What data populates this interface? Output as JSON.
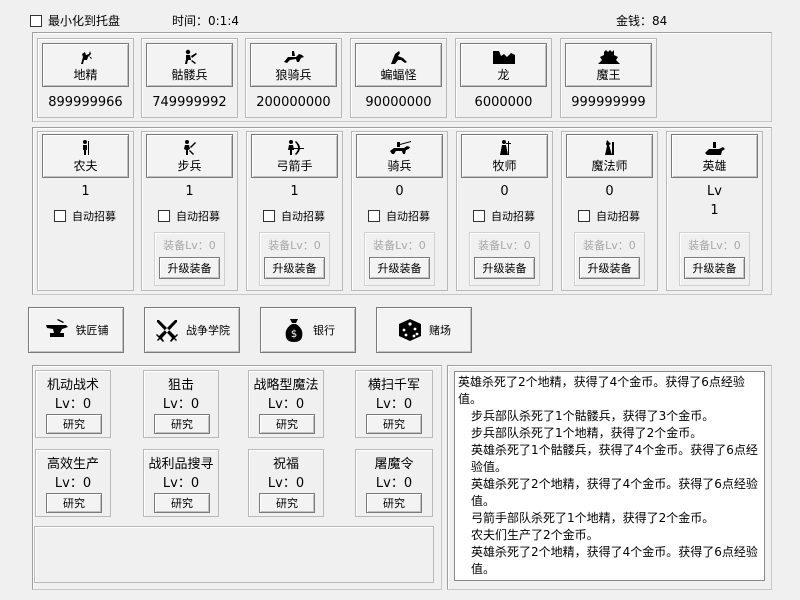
{
  "topbar": {
    "minimize_label": "最小化到托盘",
    "time_label": "时间：0:1:4",
    "money_label": "金钱：84"
  },
  "enemies": [
    {
      "name": "地精",
      "count": "899999966",
      "icon": "goblin-icon"
    },
    {
      "name": "骷髅兵",
      "count": "749999992",
      "icon": "skeleton-icon"
    },
    {
      "name": "狼骑兵",
      "count": "200000000",
      "icon": "wolf-rider-icon"
    },
    {
      "name": "蝙蝠怪",
      "count": "90000000",
      "icon": "bat-icon"
    },
    {
      "name": "龙",
      "count": "6000000",
      "icon": "dragon-icon"
    },
    {
      "name": "魔王",
      "count": "999999999",
      "icon": "demon-king-icon"
    }
  ],
  "units": [
    {
      "name": "农夫",
      "count": "1",
      "auto_label": "自动招募",
      "icon": "farmer-icon"
    },
    {
      "name": "步兵",
      "count": "1",
      "auto_label": "自动招募",
      "equip_label": "装备Lv：0",
      "upgrade_label": "升级装备",
      "icon": "infantry-icon"
    },
    {
      "name": "弓箭手",
      "count": "1",
      "auto_label": "自动招募",
      "equip_label": "装备Lv：0",
      "upgrade_label": "升级装备",
      "icon": "archer-icon"
    },
    {
      "name": "骑兵",
      "count": "0",
      "auto_label": "自动招募",
      "equip_label": "装备Lv：0",
      "upgrade_label": "升级装备",
      "icon": "cavalry-icon"
    },
    {
      "name": "牧师",
      "count": "0",
      "auto_label": "自动招募",
      "equip_label": "装备Lv：0",
      "upgrade_label": "升级装备",
      "icon": "priest-icon"
    },
    {
      "name": "魔法师",
      "count": "0",
      "auto_label": "自动招募",
      "equip_label": "装备Lv：0",
      "upgrade_label": "升级装备",
      "icon": "mage-icon"
    }
  ],
  "hero": {
    "name": "英雄",
    "lv_label": "Lv",
    "lv_value": "1",
    "equip_label": "装备Lv：0",
    "upgrade_label": "升级装备",
    "icon": "hero-icon"
  },
  "buildings": [
    {
      "label": "铁匠铺",
      "icon": "anvil-icon"
    },
    {
      "label": "战争学院",
      "icon": "crossed-swords-icon"
    },
    {
      "label": "银行",
      "icon": "money-bag-icon"
    },
    {
      "label": "赌场",
      "icon": "dice-icon"
    }
  ],
  "research": [
    {
      "title": "机动战术",
      "lv": "Lv：0",
      "button": "研究"
    },
    {
      "title": "狙击",
      "lv": "Lv：0",
      "button": "研究"
    },
    {
      "title": "战略型魔法",
      "lv": "Lv：0",
      "button": "研究"
    },
    {
      "title": "横扫千军",
      "lv": "Lv：0",
      "button": "研究"
    },
    {
      "title": "高效生产",
      "lv": "Lv：0",
      "button": "研究"
    },
    {
      "title": "战利品搜寻",
      "lv": "Lv：0",
      "button": "研究"
    },
    {
      "title": "祝福",
      "lv": "Lv：0",
      "button": "研究"
    },
    {
      "title": "屠魔令",
      "lv": "Lv：0",
      "button": "研究"
    }
  ],
  "log": [
    "英雄杀死了2个地精，获得了4个金币。获得了6点经验值。",
    "步兵部队杀死了1个骷髅兵，获得了3个金币。",
    "步兵部队杀死了1个地精，获得了2个金币。",
    "英雄杀死了1个骷髅兵，获得了4个金币。获得了6点经验值。",
    "英雄杀死了2个地精，获得了4个金币。获得了6点经验值。",
    "弓箭手部队杀死了1个地精，获得了2个金币。",
    "农夫们生产了2个金币。",
    "英雄杀死了2个地精，获得了4个金币。获得了6点经验值。"
  ]
}
